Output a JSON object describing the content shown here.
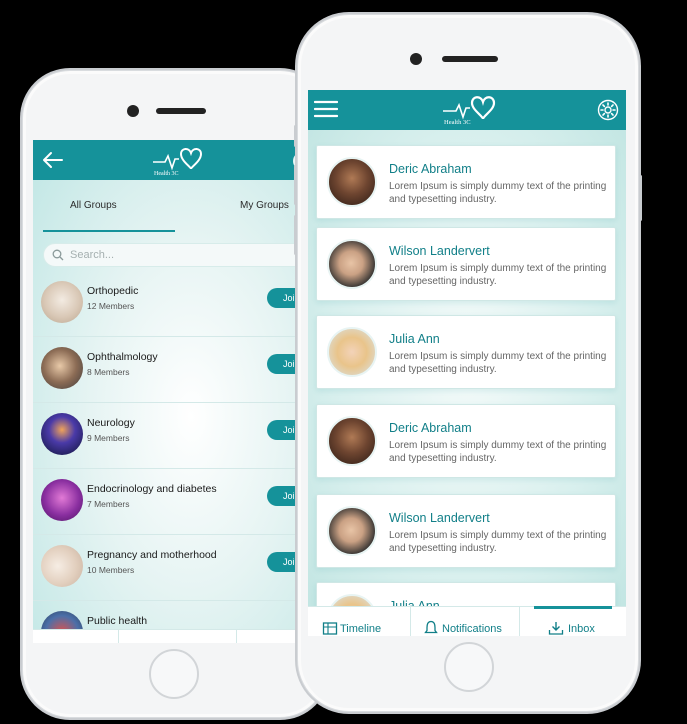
{
  "left_phone": {
    "header": {
      "logo_text": "Health 3C"
    },
    "tabs": {
      "all": "All Groups",
      "my": "My Groups"
    },
    "search": {
      "placeholder": "Search..."
    },
    "groups": [
      {
        "name": "Orthopedic",
        "members": "12 Members",
        "join": "Join",
        "icon": "orthopedic-avatar"
      },
      {
        "name": "Ophthalmology",
        "members": "8 Members",
        "join": "Join",
        "icon": "ophthalmology-avatar"
      },
      {
        "name": "Neurology",
        "members": "9 Members",
        "join": "Join",
        "icon": "neurology-avatar"
      },
      {
        "name": "Endocrinology and diabetes",
        "members": "7 Members",
        "join": "Join",
        "icon": "endocrinology-avatar"
      },
      {
        "name": "Pregnancy and motherhood",
        "members": "10 Members",
        "join": "Join",
        "icon": "pregnancy-avatar"
      },
      {
        "name": "Public health",
        "members": "",
        "join": "",
        "icon": "public-health-avatar"
      }
    ]
  },
  "right_phone": {
    "header": {
      "logo_text": "Health 3C"
    },
    "messages": [
      {
        "name": "Deric Abraham",
        "text": "Lorem Ipsum is simply dummy text of the printing and typesetting industry."
      },
      {
        "name": "Wilson Landervert",
        "text": "Lorem Ipsum is simply dummy text of the printing and typesetting industry."
      },
      {
        "name": "Julia Ann",
        "text": "Lorem Ipsum is simply dummy text of the printing and typesetting industry."
      },
      {
        "name": "Deric Abraham",
        "text": "Lorem Ipsum is simply dummy text of the printing and typesetting industry."
      },
      {
        "name": "Wilson Landervert",
        "text": "Lorem Ipsum is simply dummy text of the printing and typesetting industry."
      },
      {
        "name": "Julia Ann",
        "text": ""
      }
    ],
    "bottom_nav": [
      {
        "label": "Timeline",
        "icon": "timeline-icon"
      },
      {
        "label": "Notifications",
        "icon": "bell-icon"
      },
      {
        "label": "Inbox",
        "icon": "inbox-icon",
        "active": true
      }
    ]
  },
  "colors": {
    "primary": "#15929a",
    "name_text": "#117f88",
    "background": "#000000"
  }
}
